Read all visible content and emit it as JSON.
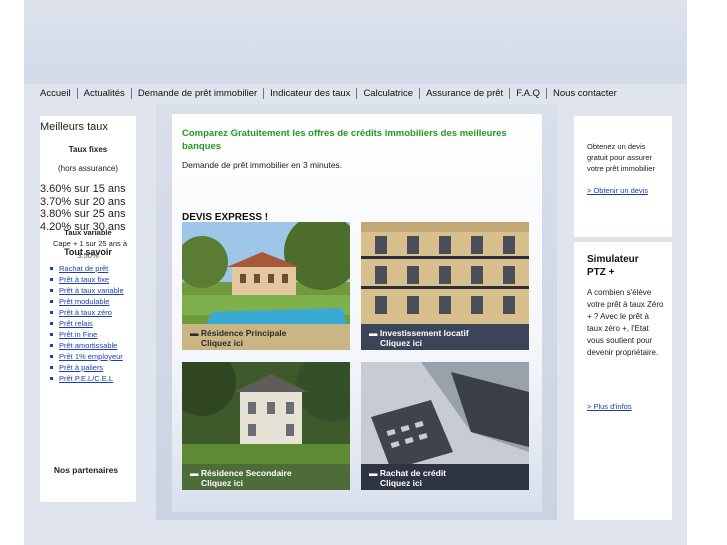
{
  "nav": [
    "Accueil",
    "Actualités",
    "Demande de prêt immobilier",
    "Indicateur des taux",
    "Calculatrice",
    "Assurance de prêt",
    "F.A.Q",
    "Nous contacter"
  ],
  "left": {
    "title": "Meilleurs taux",
    "fixed_title": "Taux fixes",
    "fixed_note": "(hors assurance)",
    "rates": [
      "3.60% sur 15 ans",
      "3.70% sur 20 ans",
      "3.80% sur 25 ans",
      "4.20% sur 30 ans"
    ],
    "variable_title": "Taux variable",
    "variable_text": "Cape + 1 sur 25 ans à",
    "variable_text_tail": "3.50%",
    "know_title": "Tout savoir",
    "links": [
      "Rachat de prêt",
      "Prêt à taux fixe",
      "Prêt à taux variable",
      "Prêt modulable",
      "Prêt à taux zéro",
      "Prêt relais",
      "Prêt in Fine",
      "Prêt amortissable",
      "Prêt 1% employeur",
      "Prêt à paliers",
      "Prêt P.E.L/C.E.L"
    ],
    "partners": "Nos partenaires"
  },
  "main": {
    "intro": "Comparez Gratuitement les offres de crédits immobiliers des meilleures banques",
    "subtitle": "Demande de prêt immobilier en 3 minutes.",
    "devis_title": "DEVIS EXPRESS !",
    "cards": [
      {
        "label": "Résidence Principale",
        "cta": "Cliquez ici"
      },
      {
        "label": "Investissement locatif",
        "cta": "Cliquez ici"
      },
      {
        "label": "Résidence Secondaire",
        "cta": "Cliquez ici"
      },
      {
        "label": "Rachat de crédit",
        "cta": "Cliquez ici"
      }
    ]
  },
  "right": {
    "devis_text": "Obtenez un devis gratuit pour assurer votre prêt immobilier",
    "devis_link": "> Obtenir un devis",
    "ptz_title": "Simulateur PTZ +",
    "ptz_text": "A combien s'élève votre prêt à taux Zéro + ? Avec le prêt à taux zéro +, l'Etat vous soutient pour devenir propriétaire.",
    "ptz_link": "> Plus d'infos"
  },
  "colors": {
    "intro_green": "#229922",
    "link_blue": "#1b3fb0",
    "bar_gold": "#c4b07a",
    "bar_dark": "#3a4255",
    "bar_green": "#4a6b3a"
  }
}
